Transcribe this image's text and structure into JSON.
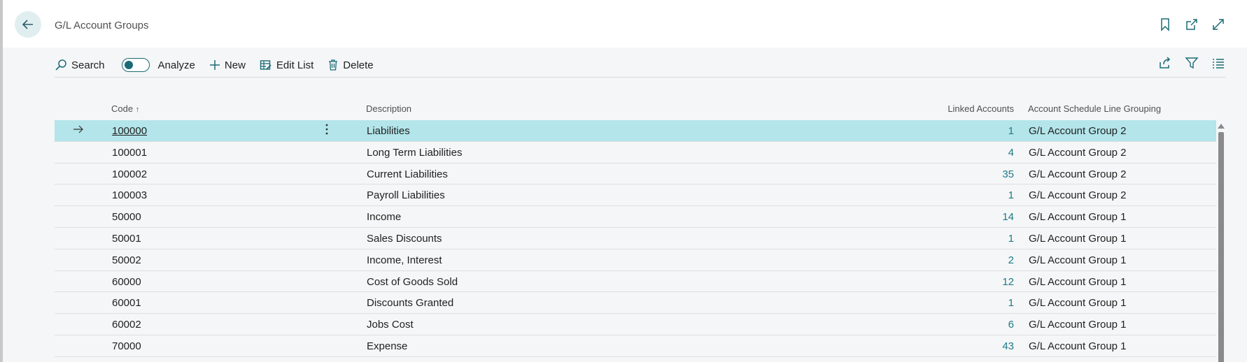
{
  "header": {
    "title": "G/L Account Groups",
    "icons": [
      "bookmark-icon",
      "open-new-window-icon",
      "expand-icon"
    ]
  },
  "actions": {
    "search": "Search",
    "analyze": "Analyze",
    "new": "New",
    "edit_list": "Edit List",
    "delete": "Delete",
    "right_icons": [
      "share-icon",
      "filter-icon",
      "list-view-icon"
    ]
  },
  "table": {
    "columns": {
      "code": "Code",
      "description": "Description",
      "linked": "Linked Accounts",
      "grouping": "Account Schedule Line Grouping"
    },
    "rows": [
      {
        "code": "100000",
        "description": "Liabilities",
        "linked": "1",
        "grouping": "G/L Account Group 2"
      },
      {
        "code": "100001",
        "description": "Long Term Liabilities",
        "linked": "4",
        "grouping": "G/L Account Group 2"
      },
      {
        "code": "100002",
        "description": "Current Liabilities",
        "linked": "35",
        "grouping": "G/L Account Group 2"
      },
      {
        "code": "100003",
        "description": "Payroll Liabilities",
        "linked": "1",
        "grouping": "G/L Account Group 2"
      },
      {
        "code": "50000",
        "description": "Income",
        "linked": "14",
        "grouping": "G/L Account Group 1"
      },
      {
        "code": "50001",
        "description": "Sales Discounts",
        "linked": "1",
        "grouping": "G/L Account Group 1"
      },
      {
        "code": "50002",
        "description": "Income, Interest",
        "linked": "2",
        "grouping": "G/L Account Group 1"
      },
      {
        "code": "60000",
        "description": "Cost of Goods Sold",
        "linked": "12",
        "grouping": "G/L Account Group 1"
      },
      {
        "code": "60001",
        "description": "Discounts Granted",
        "linked": "1",
        "grouping": "G/L Account Group 1"
      },
      {
        "code": "60002",
        "description": "Jobs Cost",
        "linked": "6",
        "grouping": "G/L Account Group 1"
      },
      {
        "code": "70000",
        "description": "Expense",
        "linked": "43",
        "grouping": "G/L Account Group 1"
      }
    ]
  },
  "colors": {
    "accent": "#1b6b77",
    "selected_row": "#b3e5ea",
    "link_number": "#1b7b86"
  }
}
